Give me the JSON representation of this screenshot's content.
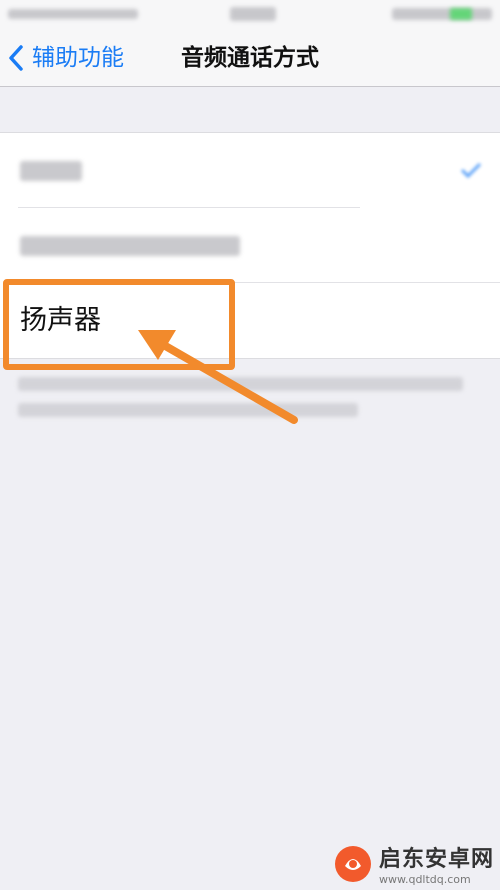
{
  "nav": {
    "back_label": "辅助功能",
    "title": "音频通话方式"
  },
  "options": [
    {
      "label": ""
    },
    {
      "label": ""
    },
    {
      "label": "扬声器"
    }
  ],
  "annotation": {
    "color": "#f28a2c"
  },
  "colors": {
    "accent": "#1a7cf5",
    "background": "#efeff4",
    "annotation": "#f28a2c"
  },
  "watermark": {
    "name": "启东安卓网",
    "url": "www.qdltdq.com"
  }
}
